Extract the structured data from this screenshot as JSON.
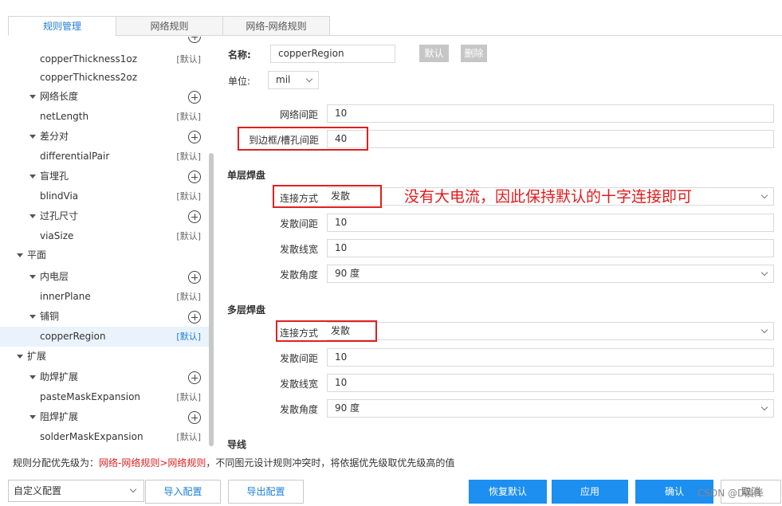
{
  "tabs": [
    "规则管理",
    "网络规则",
    "网络-网络规则"
  ],
  "tree": {
    "default_label": "[默认]",
    "rows": [
      {
        "label": "copperThickness1oz",
        "has_default": true
      },
      {
        "label": "copperThickness2oz",
        "has_default": false
      },
      {
        "label": "网络长度",
        "group": true
      },
      {
        "label": "netLength",
        "has_default": true
      },
      {
        "label": "差分对",
        "group": true
      },
      {
        "label": "differentialPair",
        "has_default": true
      },
      {
        "label": "盲埋孔",
        "group": true
      },
      {
        "label": "blindVia",
        "has_default": true
      },
      {
        "label": "过孔尺寸",
        "group": true
      },
      {
        "label": "viaSize",
        "has_default": true
      },
      {
        "label": "平面",
        "top_group": true
      },
      {
        "label": "内电层",
        "group": true
      },
      {
        "label": "innerPlane",
        "has_default": true
      },
      {
        "label": "铺铜",
        "group": true
      },
      {
        "label": "copperRegion",
        "has_default": true,
        "selected": true
      },
      {
        "label": "扩展",
        "top_group": true
      },
      {
        "label": "助焊扩展",
        "group": true
      },
      {
        "label": "pasteMaskExpansion",
        "has_default": true
      },
      {
        "label": "阻焊扩展",
        "group": true
      },
      {
        "label": "solderMaskExpansion",
        "has_default": true
      }
    ]
  },
  "form": {
    "name_label": "名称:",
    "name_value": "copperRegion",
    "default_btn": "默认",
    "delete_btn": "删除",
    "unit_label": "单位:",
    "unit_value": "mil",
    "net_spacing_label": "网络间距",
    "net_spacing_value": "10",
    "edge_spacing_label": "到边框/槽孔间距",
    "edge_spacing_value": "40",
    "single_title": "单层焊盘",
    "single": {
      "conn_label": "连接方式",
      "conn_value": "发散",
      "gap_label": "发散间距",
      "gap_value": "10",
      "width_label": "发散线宽",
      "width_value": "10",
      "angle_label": "发散角度",
      "angle_value": "90 度"
    },
    "multi_title": "多层焊盘",
    "multi": {
      "conn_label": "连接方式",
      "conn_value": "发散",
      "gap_label": "发散间距",
      "gap_value": "10",
      "width_label": "发散线宽",
      "width_value": "10",
      "angle_label": "发散角度",
      "angle_value": "90 度"
    },
    "wire_title": "导线"
  },
  "annotation": "没有大电流，因此保持默认的十字连接即可",
  "footer": {
    "note_prefix": "规则分配优先级为：",
    "note_red": "网络-网络规则>网络规则",
    "note_suffix": "，不同图元设计规则冲突时，将依据优先级取优先级高的值",
    "config_value": "自定义配置",
    "import_btn": "导入配置",
    "export_btn": "导出配置",
    "restore_btn": "恢复默认",
    "apply_btn": "应用",
    "ok_btn": "确认",
    "cancel_btn": "取消"
  },
  "watermark": "CSDN @D晨泽",
  "colors": {
    "accent": "#1c8ff0",
    "tab_active": "#1e7ed8",
    "annotation": "#e21b1b"
  }
}
